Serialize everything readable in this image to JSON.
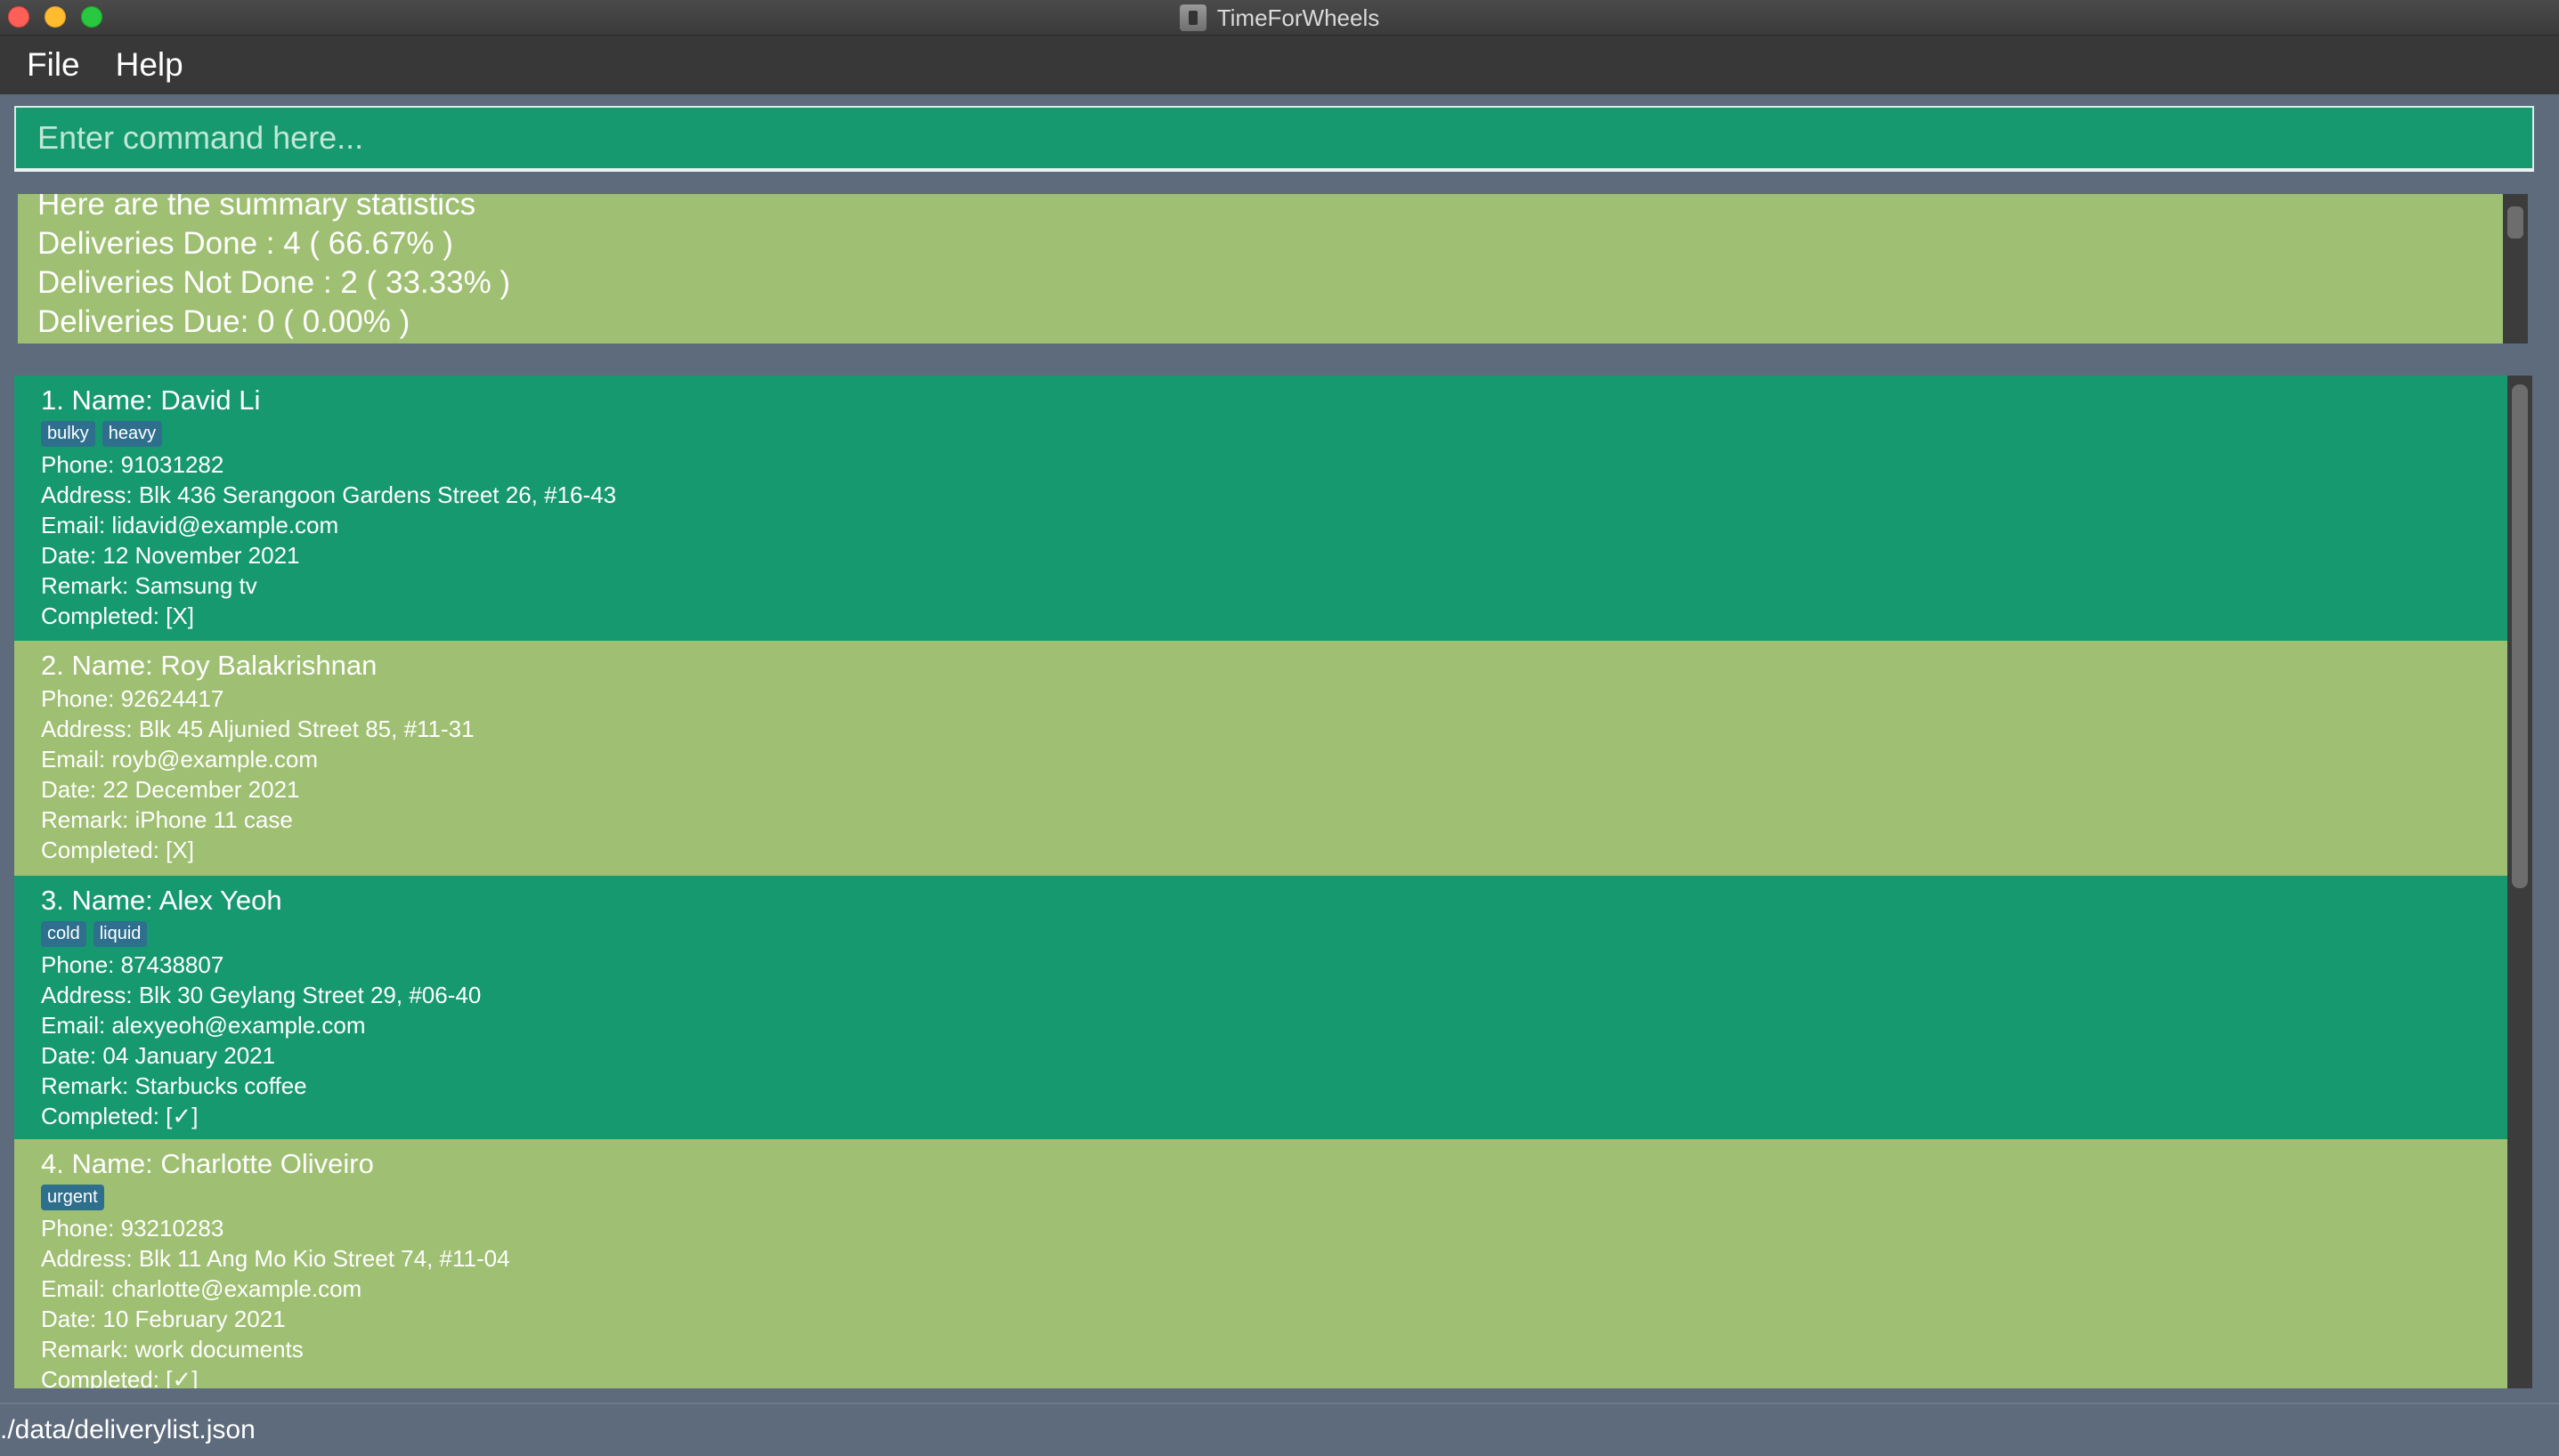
{
  "window": {
    "title": "TimeForWheels"
  },
  "menu": {
    "file": "File",
    "help": "Help"
  },
  "command": {
    "placeholder": "Enter command here..."
  },
  "result": {
    "lines": [
      "Here are the summary statistics",
      "Deliveries Done : 4 ( 66.67% )",
      "Deliveries Not Done : 2 ( 33.33% )",
      "Deliveries Due: 0 ( 0.00% )"
    ]
  },
  "deliveries": [
    {
      "title": "1.  Name: David Li",
      "tags": [
        "bulky",
        "heavy"
      ],
      "phone": "Phone: 91031282",
      "address": "Address: Blk 436 Serangoon Gardens Street 26, #16-43",
      "email": "Email: lidavid@example.com",
      "date": "Date: 12 November 2021",
      "remark": "Remark: Samsung tv",
      "completed": "Completed: [X]"
    },
    {
      "title": "2.  Name: Roy Balakrishnan",
      "tags": [],
      "phone": "Phone: 92624417",
      "address": "Address: Blk 45 Aljunied Street 85, #11-31",
      "email": "Email: royb@example.com",
      "date": "Date: 22 December 2021",
      "remark": "Remark: iPhone 11 case",
      "completed": "Completed: [X]"
    },
    {
      "title": "3.  Name: Alex Yeoh",
      "tags": [
        "cold",
        "liquid"
      ],
      "phone": "Phone: 87438807",
      "address": "Address: Blk 30 Geylang Street 29, #06-40",
      "email": "Email: alexyeoh@example.com",
      "date": "Date: 04 January 2021",
      "remark": "Remark: Starbucks coffee",
      "completed": "Completed: [✓]"
    },
    {
      "title": "4.  Name: Charlotte Oliveiro",
      "tags": [
        "urgent"
      ],
      "phone": "Phone: 93210283",
      "address": "Address: Blk 11 Ang Mo Kio Street 74, #11-04",
      "email": "Email: charlotte@example.com",
      "date": "Date: 10 February 2021",
      "remark": "Remark: work documents",
      "completed": "Completed: [✓]"
    }
  ],
  "status": {
    "path": "./data/deliverylist.json"
  }
}
